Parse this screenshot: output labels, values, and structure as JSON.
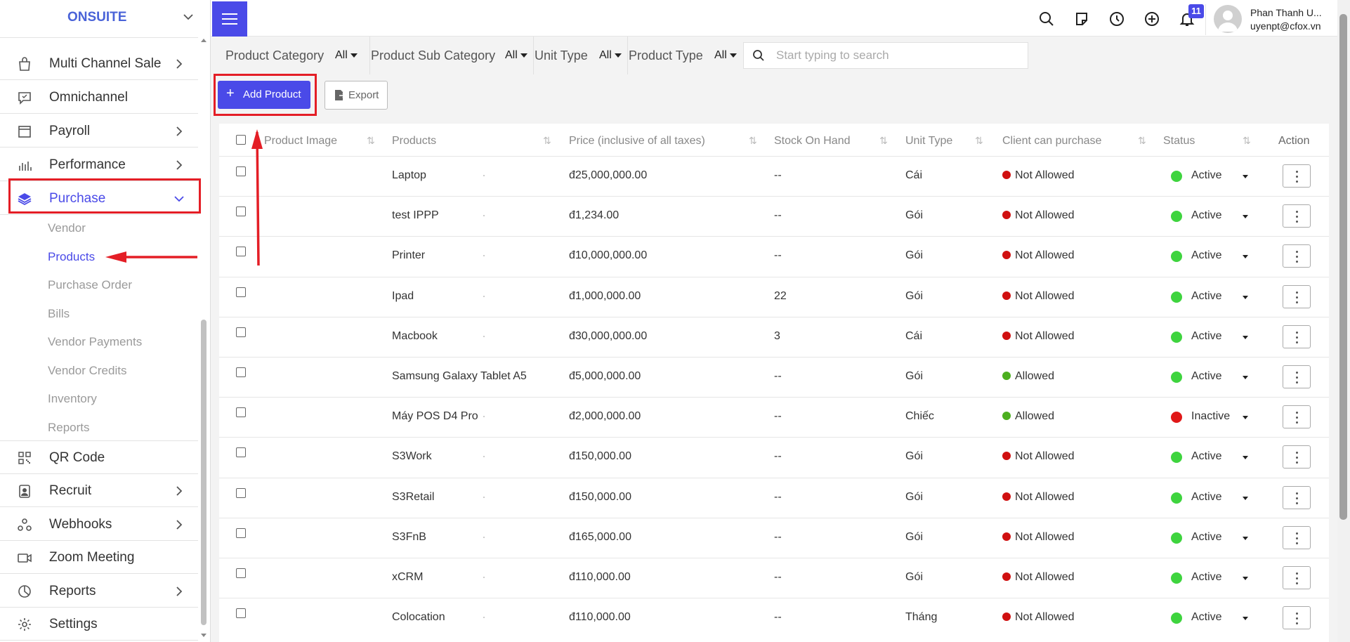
{
  "brand": "ONSUITE",
  "sidebar": {
    "items": [
      {
        "label": "Multi Channel Sale",
        "icon": "shopping-bag-icon",
        "has_chevron": true
      },
      {
        "label": "Omnichannel",
        "icon": "chat-icon",
        "has_chevron": false
      },
      {
        "label": "Payroll",
        "icon": "payroll-icon",
        "has_chevron": true
      },
      {
        "label": "Performance",
        "icon": "bar-chart-icon",
        "has_chevron": true
      },
      {
        "label": "Purchase",
        "icon": "layers-icon",
        "has_chevron": true,
        "expanded": true
      }
    ],
    "sub_items": [
      "Vendor",
      "Products",
      "Purchase Order",
      "Bills",
      "Vendor Payments",
      "Vendor Credits",
      "Inventory",
      "Reports"
    ],
    "active_sub_item": "Products",
    "bottom_items": [
      {
        "label": "QR Code",
        "icon": "qr-code-icon",
        "has_chevron": false
      },
      {
        "label": "Recruit",
        "icon": "recruit-icon",
        "has_chevron": true
      },
      {
        "label": "Webhooks",
        "icon": "webhook-icon",
        "has_chevron": true
      },
      {
        "label": "Zoom Meeting",
        "icon": "video-icon",
        "has_chevron": false
      },
      {
        "label": "Reports",
        "icon": "pie-chart-icon",
        "has_chevron": true
      },
      {
        "label": "Settings",
        "icon": "gear-icon",
        "has_chevron": false
      }
    ]
  },
  "header": {
    "notification_count": "11",
    "user_name": "Phan Thanh U...",
    "user_email": "uyenpt@cfox.vn",
    "icons": [
      "search-icon",
      "note-icon",
      "clock-icon",
      "plus-circle-icon",
      "bell-icon"
    ]
  },
  "filters": {
    "product_category_label": "Product Category",
    "product_category_value": "All",
    "product_sub_category_label": "Product Sub Category",
    "product_sub_category_value": "All",
    "unit_type_label": "Unit Type",
    "unit_type_value": "All",
    "product_type_label": "Product Type",
    "product_type_value": "All",
    "search_placeholder": "Start typing to search"
  },
  "toolbar": {
    "add_label": "Add Product",
    "export_label": "Export"
  },
  "table": {
    "columns": [
      "Product Image",
      "Products",
      "Price (inclusive of all taxes)",
      "Stock On Hand",
      "Unit Type",
      "Client can purchase",
      "Status",
      "Action"
    ],
    "rows": [
      {
        "name": "Laptop",
        "price": "đ25,000,000.00",
        "stock": "--",
        "unit": "Cái",
        "client": "Not Allowed",
        "status": "Active"
      },
      {
        "name": "test IPPP",
        "price": "đ1,234.00",
        "stock": "--",
        "unit": "Gói",
        "client": "Not Allowed",
        "status": "Active"
      },
      {
        "name": "Printer",
        "price": "đ10,000,000.00",
        "stock": "--",
        "unit": "Gói",
        "client": "Not Allowed",
        "status": "Active"
      },
      {
        "name": "Ipad",
        "price": "đ1,000,000.00",
        "stock": "22",
        "unit": "Gói",
        "client": "Not Allowed",
        "status": "Active"
      },
      {
        "name": "Macbook",
        "price": "đ30,000,000.00",
        "stock": "3",
        "unit": "Cái",
        "client": "Not Allowed",
        "status": "Active"
      },
      {
        "name": "Samsung Galaxy Tablet A5",
        "price": "đ5,000,000.00",
        "stock": "--",
        "unit": "Gói",
        "client": "Allowed",
        "status": "Active"
      },
      {
        "name": "Máy POS D4 Pro",
        "price": "đ2,000,000.00",
        "stock": "--",
        "unit": "Chiếc",
        "client": "Allowed",
        "status": "Inactive"
      },
      {
        "name": "S3Work",
        "price": "đ150,000.00",
        "stock": "--",
        "unit": "Gói",
        "client": "Not Allowed",
        "status": "Active"
      },
      {
        "name": "S3Retail",
        "price": "đ150,000.00",
        "stock": "--",
        "unit": "Gói",
        "client": "Not Allowed",
        "status": "Active"
      },
      {
        "name": "S3FnB",
        "price": "đ165,000.00",
        "stock": "--",
        "unit": "Gói",
        "client": "Not Allowed",
        "status": "Active"
      },
      {
        "name": "xCRM",
        "price": "đ110,000.00",
        "stock": "--",
        "unit": "Gói",
        "client": "Not Allowed",
        "status": "Active"
      },
      {
        "name": "Colocation",
        "price": "đ110,000.00",
        "stock": "--",
        "unit": "Tháng",
        "client": "Not Allowed",
        "status": "Active"
      }
    ]
  },
  "colors": {
    "accent": "#4a4ae8",
    "annotation_red": "#e41e26",
    "status_active": "#3ed43e",
    "status_inactive": "#e01818",
    "allowed": "#4caf1f",
    "not_allowed": "#d01010"
  }
}
